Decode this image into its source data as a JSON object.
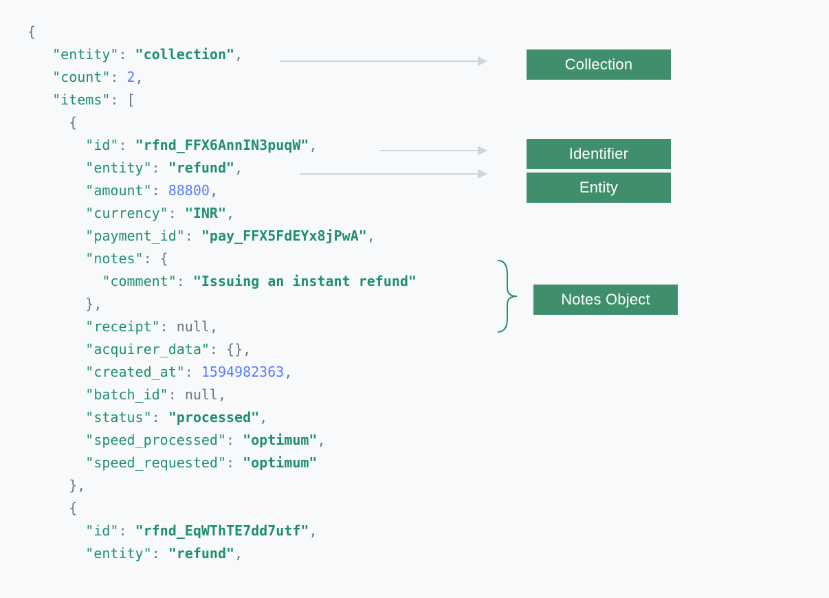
{
  "json": {
    "entity_key": "\"entity\"",
    "entity_val": "\"collection\"",
    "count_key": "\"count\"",
    "count_val": "2",
    "items_key": "\"items\"",
    "item1": {
      "id_key": "\"id\"",
      "id_val": "\"rfnd_FFX6AnnIN3puqW\"",
      "entity_key": "\"entity\"",
      "entity_val": "\"refund\"",
      "amount_key": "\"amount\"",
      "amount_val": "88800",
      "currency_key": "\"currency\"",
      "currency_val": "\"INR\"",
      "payment_id_key": "\"payment_id\"",
      "payment_id_val": "\"pay_FFX5FdEYx8jPwA\"",
      "notes_key": "\"notes\"",
      "comment_key": "\"comment\"",
      "comment_val": "\"Issuing an instant refund\"",
      "receipt_key": "\"receipt\"",
      "receipt_val": "null",
      "acquirer_key": "\"acquirer_data\"",
      "acquirer_val": "{}",
      "created_key": "\"created_at\"",
      "created_val": "1594982363",
      "batch_key": "\"batch_id\"",
      "batch_val": "null",
      "status_key": "\"status\"",
      "status_val": "\"processed\"",
      "speed_p_key": "\"speed_processed\"",
      "speed_p_val": "\"optimum\"",
      "speed_r_key": "\"speed_requested\"",
      "speed_r_val": "\"optimum\""
    },
    "item2": {
      "id_key": "\"id\"",
      "id_val": "\"rfnd_EqWThTE7dd7utf\"",
      "entity_key": "\"entity\"",
      "entity_val": "\"refund\""
    }
  },
  "labels": {
    "collection": "Collection",
    "identifier": "Identifier",
    "entity": "Entity",
    "notes": "Notes Object"
  }
}
